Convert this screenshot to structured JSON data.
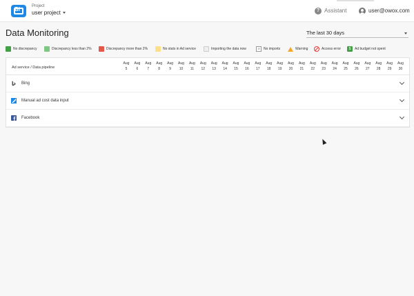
{
  "app": {
    "logo_text": "BI",
    "project_label": "Project",
    "project_name": "user project",
    "assistant_label": "Assistant",
    "user_email": "user@owox.com"
  },
  "page": {
    "title": "Data Monitoring",
    "period": "The last 30 days"
  },
  "legend": [
    {
      "label": "No discrepancy",
      "color": "#43a047"
    },
    {
      "label": "Discrepancy less than 2%",
      "color": "#81c784"
    },
    {
      "label": "Discrepancy more than 2%",
      "color": "#e5574b"
    },
    {
      "label": "No stats in Ad service",
      "color": "#ffe08a"
    },
    {
      "label": "Importing the data now",
      "color": "#eeeeee"
    },
    {
      "label": "No imports",
      "icon": "no-imports-icon"
    },
    {
      "label": "Warning",
      "icon": "warning-icon",
      "color": "#f5a623"
    },
    {
      "label": "Access error",
      "icon": "access-error-icon",
      "color": "#e53935"
    },
    {
      "label": "Ad budget not spent",
      "icon": "budget-icon",
      "color": "#43a047"
    }
  ],
  "table": {
    "header_service": "Ad service / Data pipeline",
    "month": "Aug",
    "days": [
      "5",
      "6",
      "7",
      "8",
      "9",
      "10",
      "11",
      "12",
      "13",
      "14",
      "15",
      "16",
      "17",
      "18",
      "19",
      "20",
      "21",
      "22",
      "23",
      "24",
      "25",
      "26",
      "27",
      "28",
      "29",
      "30"
    ],
    "rows": [
      {
        "label": "Bing",
        "icon": "bing-icon",
        "color": "#555555"
      },
      {
        "label": "Manual ad cost data input",
        "icon": "manual-input-icon",
        "color": "#1e88e5"
      },
      {
        "label": "Facebook",
        "icon": "facebook-icon",
        "color": "#3b5998"
      }
    ]
  }
}
